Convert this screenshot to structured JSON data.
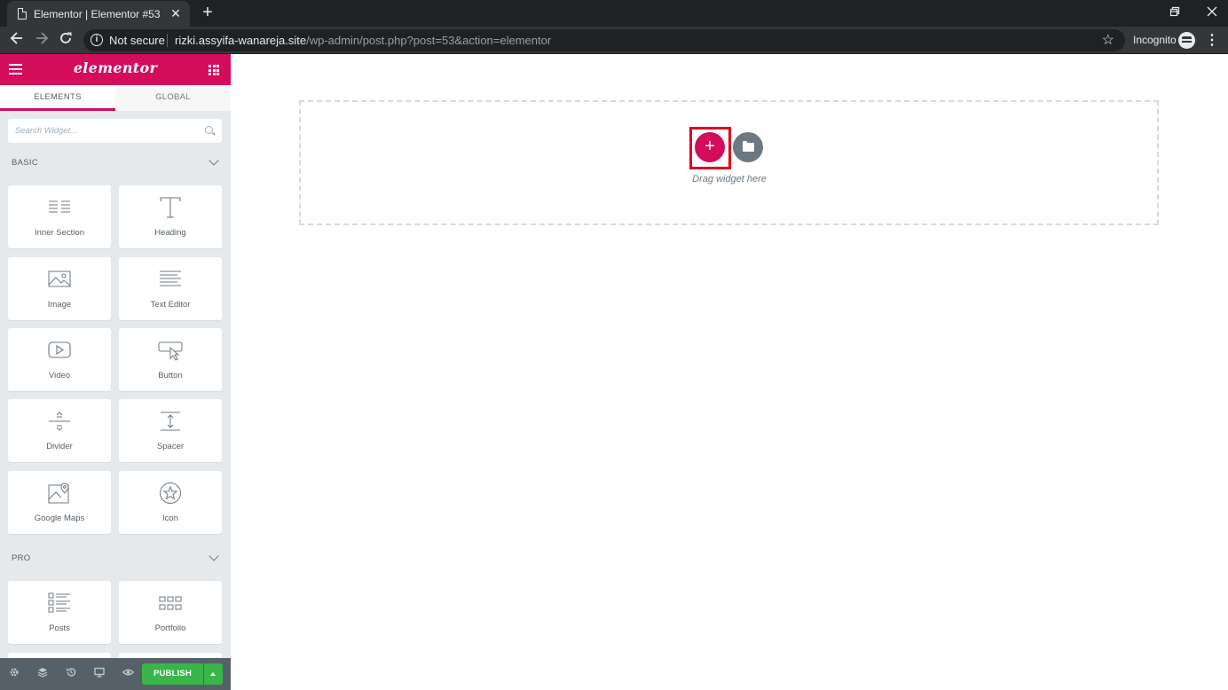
{
  "browser": {
    "tab_title": "Elementor | Elementor #53",
    "new_tab_symbol": "+",
    "tab_close_symbol": "✕",
    "security_label": "Not secure",
    "url_host": "rizki.assyifa-wanareja.site",
    "url_path": "/wp-admin/post.php?post=53&action=elementor",
    "profile_label": "Incognito",
    "icons": [
      "back-icon",
      "forward-icon",
      "reload-icon",
      "info-icon",
      "bookmark-star-icon",
      "incognito-icon",
      "menu-kebab-icon",
      "minimize-icon",
      "restore-icon",
      "close-icon"
    ]
  },
  "panel": {
    "brand": "elementor",
    "tabs": [
      {
        "label": "ELEMENTS",
        "active": true
      },
      {
        "label": "GLOBAL",
        "active": false
      }
    ],
    "search_placeholder": "Search Widget...",
    "categories": [
      {
        "title": "BASIC",
        "widgets": [
          {
            "label": "Inner Section",
            "icon": "inner-section-icon"
          },
          {
            "label": "Heading",
            "icon": "heading-icon"
          },
          {
            "label": "Image",
            "icon": "image-icon"
          },
          {
            "label": "Text Editor",
            "icon": "text-editor-icon"
          },
          {
            "label": "Video",
            "icon": "video-icon"
          },
          {
            "label": "Button",
            "icon": "button-icon"
          },
          {
            "label": "Divider",
            "icon": "divider-icon"
          },
          {
            "label": "Spacer",
            "icon": "spacer-icon"
          },
          {
            "label": "Google Maps",
            "icon": "google-maps-icon"
          },
          {
            "label": "Icon",
            "icon": "star-icon"
          }
        ]
      },
      {
        "title": "PRO",
        "widgets": [
          {
            "label": "Posts",
            "icon": "posts-icon"
          },
          {
            "label": "Portfolio",
            "icon": "portfolio-icon"
          }
        ]
      }
    ],
    "footer": {
      "icons": [
        "settings-icon",
        "navigator-icon",
        "history-icon",
        "responsive-mode-icon",
        "preview-icon"
      ],
      "publish_label": "PUBLISH"
    }
  },
  "canvas": {
    "add_section_symbol": "+",
    "drop_hint": "Drag widget here",
    "accent_color": "#d30c5c",
    "highlight_color": "#e3001b"
  }
}
